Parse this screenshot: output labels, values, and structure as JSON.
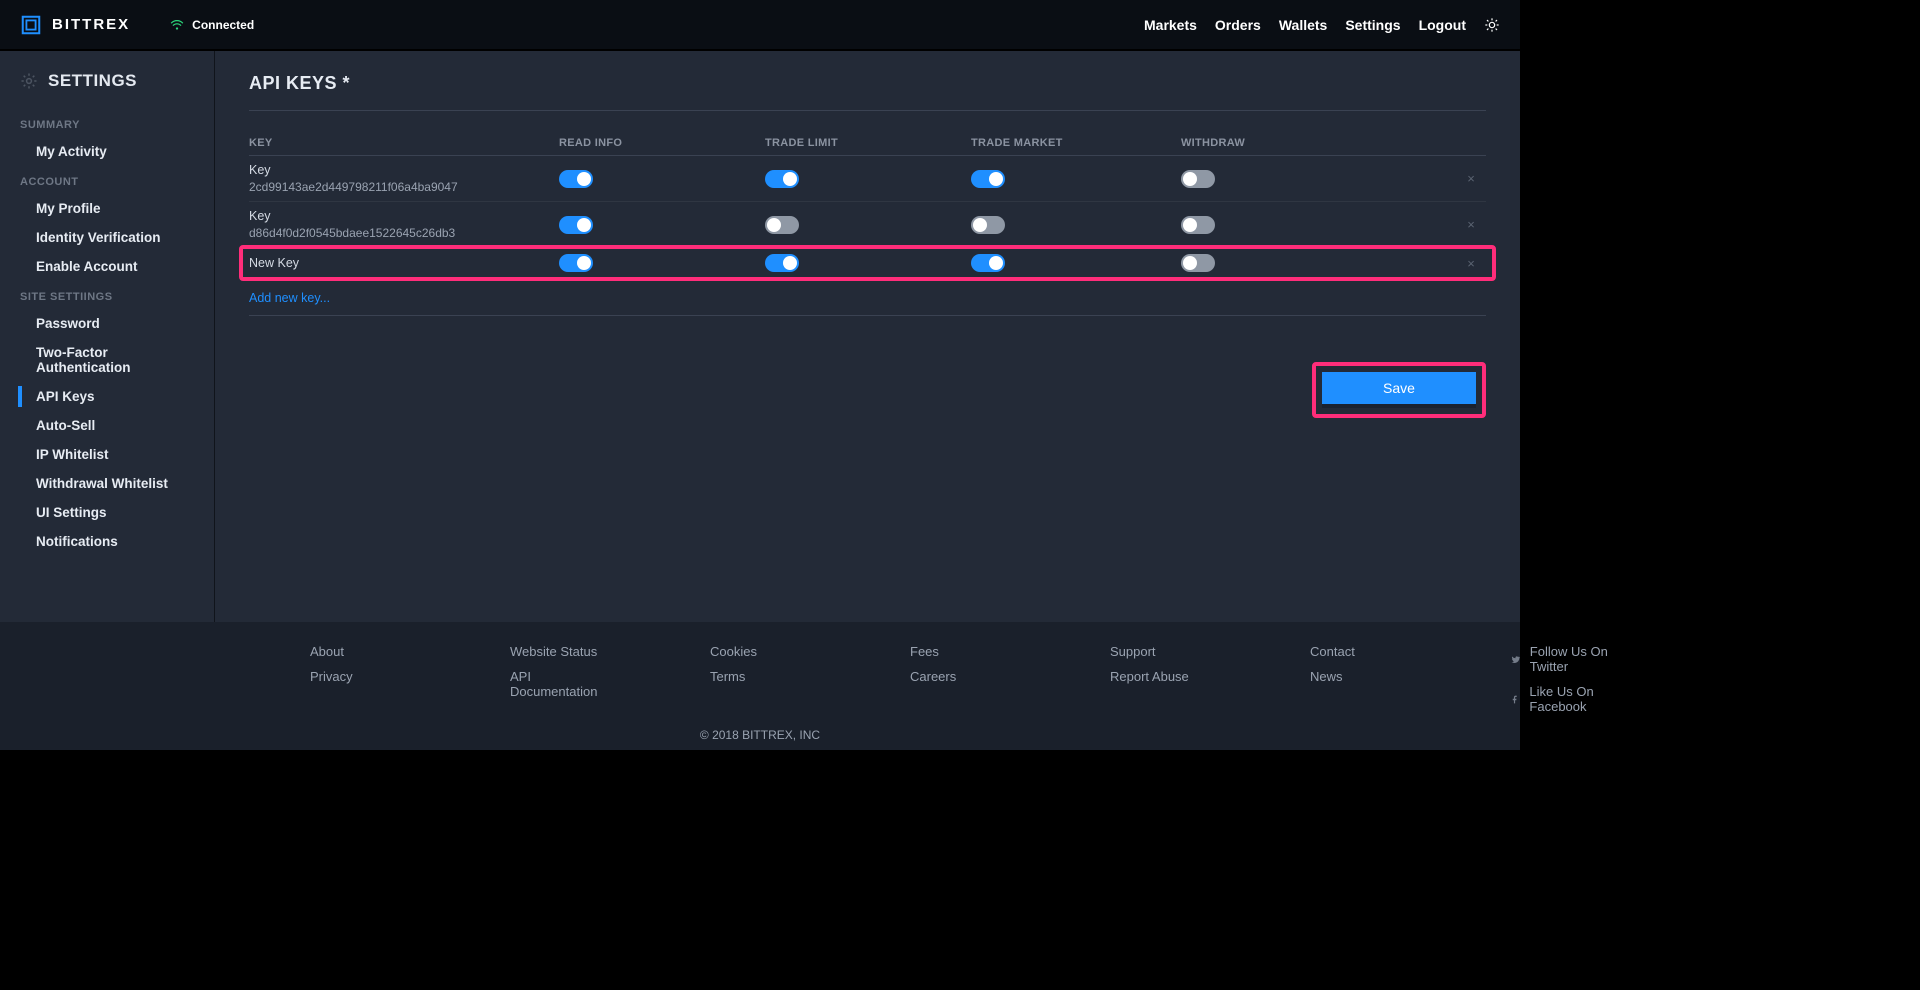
{
  "header": {
    "brand": "BITTREX",
    "connected_label": "Connected",
    "nav": [
      "Markets",
      "Orders",
      "Wallets",
      "Settings",
      "Logout"
    ]
  },
  "sidebar": {
    "title": "SETTINGS",
    "groups": [
      {
        "label": "SUMMARY",
        "items": [
          "My Activity"
        ]
      },
      {
        "label": "ACCOUNT",
        "items": [
          "My Profile",
          "Identity Verification",
          "Enable Account"
        ]
      },
      {
        "label": "SITE SETTIINGS",
        "items": [
          "Password",
          "Two-Factor Authentication",
          "API Keys",
          "Auto-Sell",
          "IP Whitelist",
          "Withdrawal Whitelist",
          "UI Settings",
          "Notifications"
        ]
      }
    ],
    "active": "API Keys"
  },
  "page": {
    "title": "API KEYS *",
    "columns": [
      "KEY",
      "READ INFO",
      "TRADE LIMIT",
      "TRADE MARKET",
      "WITHDRAW"
    ],
    "rows": [
      {
        "label": "Key",
        "value": "2cd99143ae2d449798211f06a4ba9047",
        "toggles": [
          true,
          true,
          true,
          false
        ],
        "highlight": false
      },
      {
        "label": "Key",
        "value": "d86d4f0d2f0545bdaee1522645c26db3",
        "toggles": [
          true,
          false,
          false,
          false
        ],
        "highlight": false
      },
      {
        "label": "New Key",
        "value": "",
        "toggles": [
          true,
          true,
          true,
          false
        ],
        "highlight": true
      }
    ],
    "add_link": "Add new key...",
    "save_label": "Save"
  },
  "footer": {
    "cols": [
      [
        "About",
        "Privacy"
      ],
      [
        "Website Status",
        "API Documentation"
      ],
      [
        "Cookies",
        "Terms"
      ],
      [
        "Fees",
        "Careers"
      ],
      [
        "Support",
        "Report Abuse"
      ],
      [
        "Contact",
        "News"
      ]
    ],
    "social": [
      "Follow Us On Twitter",
      "Like Us On Facebook"
    ],
    "copyright": "© 2018 BITTREX, INC"
  }
}
